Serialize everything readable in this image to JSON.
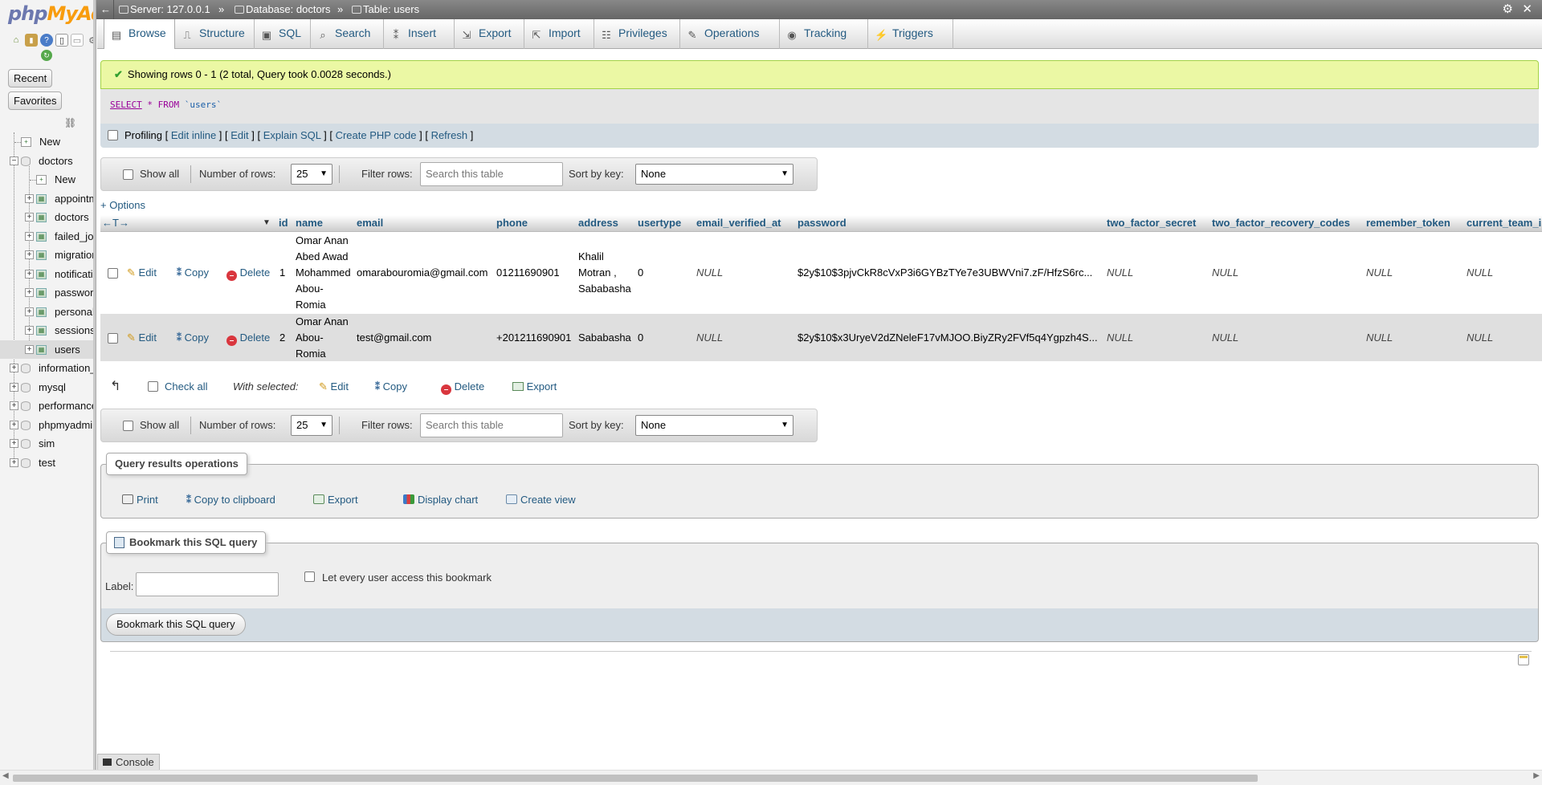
{
  "nav": {
    "logo_a": "php",
    "logo_b": "MyAdmin",
    "recent": "Recent",
    "favorites": "Favorites",
    "tree": [
      {
        "label": "New",
        "kind": "new",
        "level": 0
      },
      {
        "label": "doctors",
        "kind": "db-open",
        "level": 0
      },
      {
        "label": "New",
        "kind": "new",
        "level": 1
      },
      {
        "label": "appointments",
        "kind": "table",
        "level": 1
      },
      {
        "label": "doctors",
        "kind": "table",
        "level": 1
      },
      {
        "label": "failed_jobs",
        "kind": "table",
        "level": 1
      },
      {
        "label": "migrations",
        "kind": "table",
        "level": 1
      },
      {
        "label": "notifications",
        "kind": "table",
        "level": 1
      },
      {
        "label": "password_resets",
        "kind": "table",
        "level": 1
      },
      {
        "label": "personal_access_tokens",
        "kind": "table",
        "level": 1
      },
      {
        "label": "sessions",
        "kind": "table",
        "level": 1
      },
      {
        "label": "users",
        "kind": "table",
        "level": 1
      },
      {
        "label": "information_schema",
        "kind": "db",
        "level": 0
      },
      {
        "label": "mysql",
        "kind": "db",
        "level": 0
      },
      {
        "label": "performance_schema",
        "kind": "db",
        "level": 0
      },
      {
        "label": "phpmyadmin",
        "kind": "db",
        "level": 0
      },
      {
        "label": "sim",
        "kind": "db",
        "level": 0
      },
      {
        "label": "test",
        "kind": "db",
        "level": 0
      }
    ]
  },
  "topbar": {
    "server": "Server: 127.0.0.1",
    "database": "Database: doctors",
    "table": "Table: users",
    "sep": "»"
  },
  "tabs": [
    {
      "label": "Browse",
      "icon": "browse-icon",
      "active": true
    },
    {
      "label": "Structure",
      "icon": "structure-icon"
    },
    {
      "label": "SQL",
      "icon": "sql-icon"
    },
    {
      "label": "Search",
      "icon": "search-icon"
    },
    {
      "label": "Insert",
      "icon": "insert-icon"
    },
    {
      "label": "Export",
      "icon": "export-icon"
    },
    {
      "label": "Import",
      "icon": "import-icon"
    },
    {
      "label": "Privileges",
      "icon": "privileges-icon"
    },
    {
      "label": "Operations",
      "icon": "operations-icon"
    },
    {
      "label": "Tracking",
      "icon": "tracking-icon"
    },
    {
      "label": "Triggers",
      "icon": "triggers-icon"
    }
  ],
  "message": "Showing rows 0 - 1 (2 total, Query took 0.0028 seconds.)",
  "sql": {
    "select": "SELECT",
    "star": "*",
    "from": "FROM",
    "table": "`users`"
  },
  "profiling": {
    "label": "Profiling",
    "links": [
      "Edit inline",
      "Edit",
      "Explain SQL",
      "Create PHP code",
      "Refresh"
    ]
  },
  "navbar": {
    "show_all": "Show all",
    "rows_label": "Number of rows:",
    "rows_value": "25",
    "filter_label": "Filter rows:",
    "filter_placeholder": "Search this table",
    "sort_label": "Sort by key:",
    "sort_value": "None"
  },
  "options_link": "+ Options",
  "columns": [
    "id",
    "name",
    "email",
    "phone",
    "address",
    "usertype",
    "email_verified_at",
    "password",
    "two_factor_secret",
    "two_factor_recovery_codes",
    "remember_token",
    "current_team_i"
  ],
  "row_actions": {
    "edit": "Edit",
    "copy": "Copy",
    "delete": "Delete"
  },
  "rows": [
    {
      "id": "1",
      "name": "Omar Anan Abed Awad Mohammed Abou-Romia",
      "email": "omarabouromia@gmail.com",
      "phone": "01211690901",
      "address": "Khalil Motran , Sababasha",
      "usertype": "0",
      "email_verified_at": "NULL",
      "password": "$2y$10$3pjvCkR8cVxP3i6GYBzTYe7e3UBWVni7.zF/HfzS6rc...",
      "two_factor_secret": "NULL",
      "two_factor_recovery_codes": "NULL",
      "remember_token": "NULL",
      "current_team_id": "NULL"
    },
    {
      "id": "2",
      "name": "Omar Anan Abou-Romia",
      "email": "test@gmail.com",
      "phone": "+201211690901",
      "address": "Sababasha",
      "usertype": "0",
      "email_verified_at": "NULL",
      "password": "$2y$10$x3UryeV2dZNeleF17vMJOO.BiyZRy2FVf5q4Ygpzh4S...",
      "two_factor_secret": "NULL",
      "two_factor_recovery_codes": "NULL",
      "remember_token": "NULL",
      "current_team_id": "NULL"
    }
  ],
  "bulk": {
    "check_all": "Check all",
    "with_selected": "With selected:",
    "edit": "Edit",
    "copy": "Copy",
    "delete": "Delete",
    "export": "Export"
  },
  "query_ops": {
    "legend": "Query results operations",
    "print": "Print",
    "copy": "Copy to clipboard",
    "export": "Export",
    "chart": "Display chart",
    "view": "Create view"
  },
  "bookmark": {
    "legend": "Bookmark this SQL query",
    "label": "Label:",
    "share": "Let every user access this bookmark",
    "button": "Bookmark this SQL query"
  },
  "console": "Console"
}
